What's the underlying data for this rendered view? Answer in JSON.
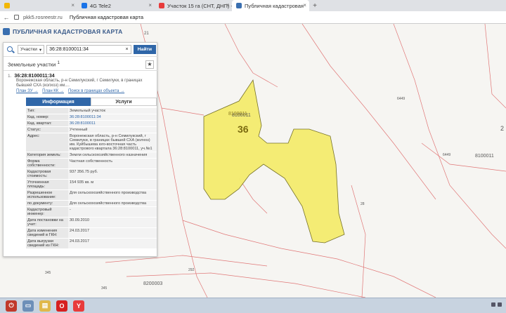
{
  "browser": {
    "tabs": [
      {
        "label": "",
        "color": "#f2b705"
      },
      {
        "label": "4G Tele2",
        "color": "#1a73e8"
      },
      {
        "label": "Участок 15 га (СНТ, ДНП) -",
        "color": "#e83b3b"
      },
      {
        "label": "Публичная кадастровая",
        "color": "#3a6fb0"
      }
    ],
    "address_host": "pkk5.rosreestr.ru",
    "address_title": "Публичная кадастровая карта"
  },
  "app": {
    "title": "ПУБЛИЧНАЯ КАДАСТРОВАЯ КАРТА",
    "search": {
      "type_label": "Участки",
      "value": "36:28:8100011:34",
      "button": "Найти"
    },
    "section_title": "Земельные участки",
    "section_count": "1",
    "star": "★"
  },
  "result": {
    "num": "1.",
    "id": "36:28:8100011:34",
    "address": "Воронежская область, р-н Семилукский, г Семилуки, в границах бывшей СХА (колхоз) им....",
    "links": [
      "План ЗУ →",
      "План КК →",
      "Поиск в границах объекта →"
    ]
  },
  "tabs": {
    "info": "Информация",
    "services": "Услуги"
  },
  "info_rows": [
    {
      "label": "Тип:",
      "value": "Земельный участок"
    },
    {
      "label": "Кад. номер:",
      "value": "36:28:8100011:34"
    },
    {
      "label": "Кад. квартал:",
      "value": "36:28:8100011"
    },
    {
      "label": "Статус:",
      "value": "Учтенный"
    },
    {
      "label": "Адрес:",
      "value": "Воронежская область, р-н Семилукский, г Семилуки, в границах бывшей СХА (колхоз) им. Куйбышева юго-восточная часть кадастрового квартала 36:28:8100011, уч.№1"
    },
    {
      "label": "Категория земель:",
      "value": "Земли сельскохозяйственного назначения"
    },
    {
      "label": "Форма собственности:",
      "value": "Частная собственность"
    },
    {
      "label": "Кадастровая стоимость:",
      "value": "937 356.75 руб."
    },
    {
      "label": "Уточненная площадь:",
      "value": "154 935 кв. м"
    },
    {
      "label": "Разрешенное использование:",
      "value": "Для сельскохозяйственного производства"
    },
    {
      "label": "по документу:",
      "value": "Для сельскохозяйственного производства"
    },
    {
      "label": "Кадастровый инженер:",
      "value": "-"
    },
    {
      "label": "Дата постановки на учет:",
      "value": "30.09.2010"
    },
    {
      "label": "Дата изменения сведений в ГКН:",
      "value": "24.03.2017"
    },
    {
      "label": "Дата выгрузки сведений из ГКН:",
      "value": "24.03.2017"
    }
  ],
  "map": {
    "parcel_label": "36",
    "quarter_label": "8100011",
    "labels": [
      "21",
      "8100011",
      "6449",
      "6449",
      "8100011",
      "28",
      "345",
      "345",
      "292",
      "8200003",
      "2"
    ]
  }
}
